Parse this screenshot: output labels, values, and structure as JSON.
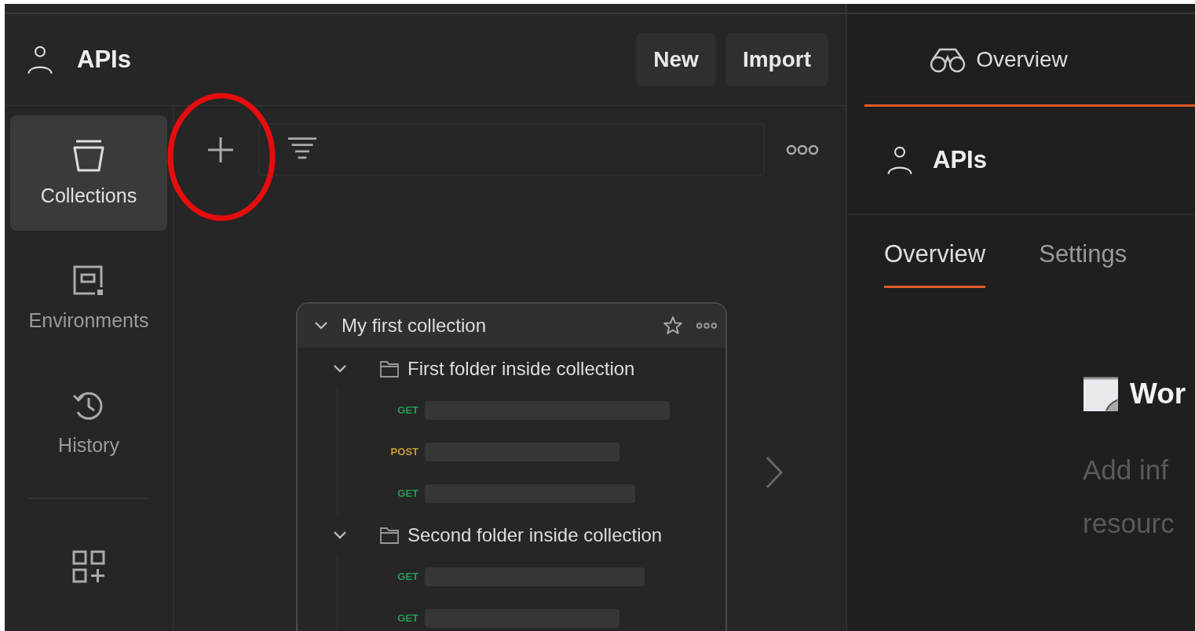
{
  "workspace": {
    "title": "APIs",
    "buttons": [
      "New",
      "Import"
    ]
  },
  "sidebar": {
    "items": [
      {
        "label": "Collections",
        "kind": "collections",
        "selected": true
      },
      {
        "label": "Environments",
        "kind": "environments",
        "selected": false
      },
      {
        "label": "History",
        "kind": "history",
        "selected": false
      }
    ]
  },
  "collection": {
    "title": "My first collection",
    "expanded": true,
    "folders": [
      {
        "name": "First folder inside collection",
        "expanded": true,
        "requests": [
          {
            "method": "GET",
            "color": "#1f9d55"
          },
          {
            "method": "POST",
            "color": "#c99a2e"
          },
          {
            "method": "GET",
            "color": "#1f9d55"
          }
        ]
      },
      {
        "name": "Second folder inside collection",
        "expanded": true,
        "requests": [
          {
            "method": "GET",
            "color": "#1f9d55"
          },
          {
            "method": "GET",
            "color": "#1f9d55"
          }
        ]
      }
    ]
  },
  "tabs": [
    {
      "label": "Overview",
      "selected": true
    }
  ],
  "overview": {
    "title": "APIs",
    "tabs": [
      {
        "label": "Overview",
        "selected": true
      },
      {
        "label": "Settings",
        "selected": false
      }
    ],
    "heading": "Wor",
    "description_lines": [
      "Add inf",
      "resourc"
    ]
  }
}
